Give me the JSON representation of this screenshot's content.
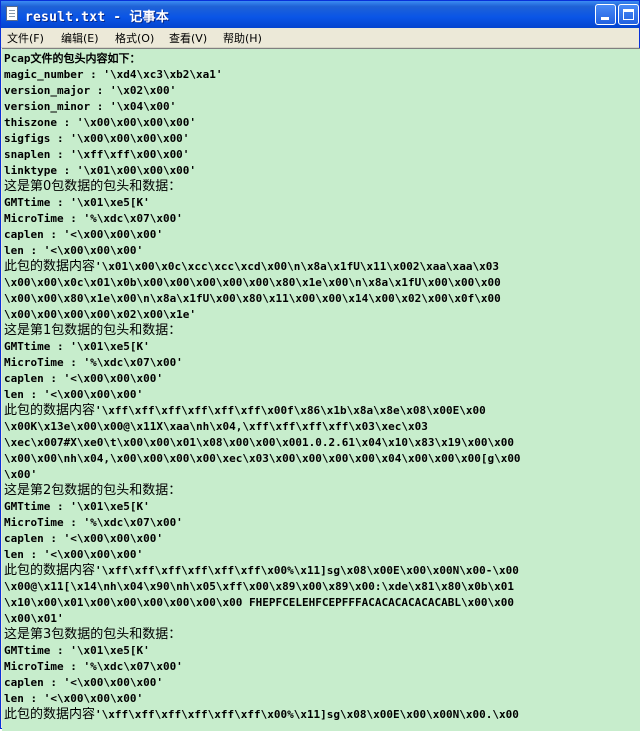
{
  "window": {
    "title": "result.txt - 记事本",
    "icon": "notepad-icon",
    "controls": [
      "minimize-icon",
      "maximize-icon",
      "close-icon"
    ]
  },
  "menu": {
    "file": "文件(F)",
    "edit": "编辑(E)",
    "format": "格式(O)",
    "view": "查看(V)",
    "help": "帮助(H)"
  },
  "colors": {
    "titlebar": "#0a55e6",
    "content_background": "#c7edcc",
    "menubar": "#ece9d8"
  },
  "document": {
    "lines": [
      "Pcap文件的包头内容如下：",
      "magic_number : '\\xd4\\xc3\\xb2\\xa1'",
      "version_major : '\\x02\\x00'",
      "version_minor : '\\x04\\x00'",
      "thiszone : '\\x00\\x00\\x00\\x00'",
      "sigfigs : '\\x00\\x00\\x00\\x00'",
      "snaplen : '\\xff\\xff\\x00\\x00'",
      "linktype : '\\x01\\x00\\x00\\x00'",
      "这是第0包数据的包头和数据：",
      "GMTtime : '\\x01\\xe5[K'",
      "MicroTime : '%\\xdc\\x07\\x00'",
      "caplen : '<\\x00\\x00\\x00'",
      "len : '<\\x00\\x00\\x00'",
      "此包的数据内容'\\x01\\x00\\x0c\\xcc\\xcc\\xcd\\x00\\n\\x8a\\x1fU\\x11\\x002\\xaa\\xaa\\x03",
      "\\x00\\x00\\x0c\\x01\\x0b\\x00\\x00\\x00\\x00\\x00\\x80\\x1e\\x00\\n\\x8a\\x1fU\\x00\\x00\\x00",
      "\\x00\\x00\\x80\\x1e\\x00\\n\\x8a\\x1fU\\x00\\x80\\x11\\x00\\x00\\x14\\x00\\x02\\x00\\x0f\\x00",
      "\\x00\\x00\\x00\\x00\\x02\\x00\\x1e'",
      "这是第1包数据的包头和数据：",
      "GMTtime : '\\x01\\xe5[K'",
      "MicroTime : '%\\xdc\\x07\\x00'",
      "caplen : '<\\x00\\x00\\x00'",
      "len : '<\\x00\\x00\\x00'",
      "此包的数据内容'\\xff\\xff\\xff\\xff\\xff\\xff\\x00f\\x86\\x1b\\x8a\\x8e\\x08\\x00E\\x00",
      "\\x00K\\x13e\\x00\\x00@\\x11X\\xaa\\nh\\x04,\\xff\\xff\\xff\\xff\\x03\\xec\\x03",
      "\\xec\\x007#X\\xe0\\t\\x00\\x00\\x01\\x08\\x00\\x00\\x001.0.2.61\\x04\\x10\\x83\\x19\\x00\\x00",
      "\\x00\\x00\\nh\\x04,\\x00\\x00\\x00\\x00\\xec\\x03\\x00\\x00\\x00\\x00\\x04\\x00\\x00\\x00[g\\x00",
      "\\x00'",
      "这是第2包数据的包头和数据：",
      "GMTtime : '\\x01\\xe5[K'",
      "MicroTime : '%\\xdc\\x07\\x00'",
      "caplen : '<\\x00\\x00\\x00'",
      "len : '<\\x00\\x00\\x00'",
      "此包的数据内容'\\xff\\xff\\xff\\xff\\xff\\xff\\x00%\\x11]sg\\x08\\x00E\\x00\\x00N\\x00-\\x00",
      "\\x00@\\x11[\\x14\\nh\\x04\\x90\\nh\\x05\\xff\\x00\\x89\\x00\\x89\\x00:\\xde\\x81\\x80\\x0b\\x01",
      "\\x10\\x00\\x01\\x00\\x00\\x00\\x00\\x00\\x00 FHEPFCELEHFCEPFFFACACACACACACABL\\x00\\x00",
      "\\x00\\x01'",
      "这是第3包数据的包头和数据：",
      "GMTtime : '\\x01\\xe5[K'",
      "MicroTime : '%\\xdc\\x07\\x00'",
      "caplen : '<\\x00\\x00\\x00'",
      "len : '<\\x00\\x00\\x00'",
      "此包的数据内容'\\xff\\xff\\xff\\xff\\xff\\xff\\x00%\\x11]sg\\x08\\x00E\\x00\\x00N\\x00.\\x00"
    ]
  }
}
